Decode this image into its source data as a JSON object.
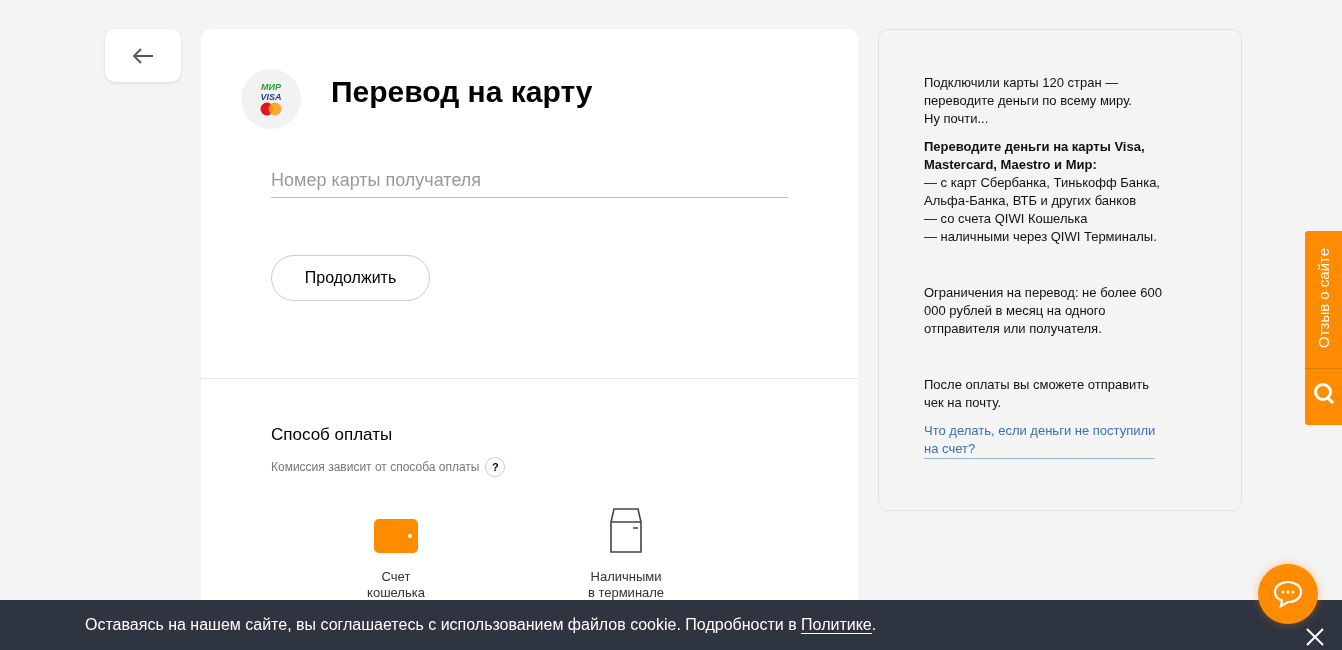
{
  "header": {
    "title": "Перевод на карту",
    "logo_text": [
      "МИР",
      "VISA"
    ]
  },
  "card_field": {
    "placeholder": "Номер карты получателя"
  },
  "continue_button": {
    "label": "Продолжить"
  },
  "payment": {
    "title": "Способ оплаты",
    "hint": "Комиссия зависит от способа оплаты",
    "help": "?",
    "methods": [
      {
        "kind": "wallet",
        "label": "Счет\nкошелька",
        "selected": true
      },
      {
        "kind": "terminal",
        "label": "Наличными\nв терминале",
        "selected": false
      }
    ]
  },
  "sidebar": {
    "paragraphs": [
      "Подключили карты 120 стран —\nпереводите деньги по всему миру.\nНу почти...",
      "**Переводите деньги на карты Visa,\nMastercard, Maestro и Мир:**\n— с карт Сбербанка, Тинькофф Банка,\nАльфа-Банка, ВТБ и других банков\n— со счета QIWI Кошелька\n— наличными через QIWI Терминалы.",
      "Ограничения на перевод: не более 600\n000 рублей в месяц на одного\nотправителя или получателя.",
      "После оплаты вы сможете отправить\nчек на почту."
    ],
    "link": "Что делать, если деньги не поступили\nна счет?"
  },
  "feedback_tab": {
    "label": "Отзыв о сайте"
  },
  "cookie_bar": {
    "text": "Оставаясь на нашем сайте, вы соглашаетесь с использованием файлов cookie. Подробности в ",
    "link": "Политике",
    "end": "."
  }
}
